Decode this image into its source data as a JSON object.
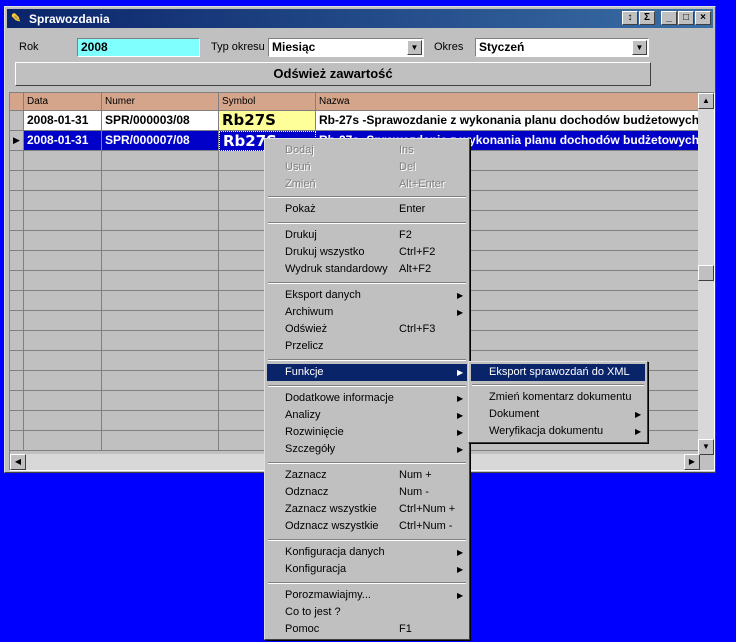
{
  "window": {
    "title": "Sprawozdania"
  },
  "titlebar_buttons": [
    "sort-icon",
    "sigma-icon",
    "minimize-icon",
    "maximize-icon",
    "close-icon"
  ],
  "filters": {
    "rok_label": "Rok",
    "rok_value": "2008",
    "typ_label": "Typ okresu",
    "typ_value": "Miesiąc",
    "okres_label": "Okres",
    "okres_value": "Styczeń"
  },
  "refresh_label": "Odśwież zawartość",
  "table": {
    "columns": [
      "Data",
      "Numer",
      "Symbol",
      "Nazwa"
    ],
    "rows": [
      {
        "data": "2008-01-31",
        "numer": "SPR/000003/08",
        "symbol": "Rb27S",
        "nazwa": "Rb-27s -Sprawozdanie z wykonania planu dochodów budżetowych"
      },
      {
        "data": "2008-01-31",
        "numer": "SPR/000007/08",
        "symbol": "Rb27S",
        "nazwa": "Rb-27s -Sprawozdanie z wykonania planu dochodów budżetowych"
      }
    ]
  },
  "context_menu": {
    "items": [
      {
        "label": "Dodaj",
        "shortcut": "Ins"
      },
      {
        "label": "Usuń",
        "shortcut": "Del"
      },
      {
        "label": "Zmień",
        "shortcut": "Alt+Enter"
      },
      {
        "label": "Pokaż",
        "shortcut": "Enter"
      },
      {
        "label": "Drukuj",
        "shortcut": "F2"
      },
      {
        "label": "Drukuj wszystko",
        "shortcut": "Ctrl+F2"
      },
      {
        "label": "Wydruk standardowy",
        "shortcut": "Alt+F2"
      },
      {
        "label": "Eksport danych",
        "shortcut": ""
      },
      {
        "label": "Archiwum",
        "shortcut": ""
      },
      {
        "label": "Odśwież",
        "shortcut": "Ctrl+F3"
      },
      {
        "label": "Przelicz",
        "shortcut": ""
      },
      {
        "label": "Funkcje",
        "shortcut": ""
      },
      {
        "label": "Dodatkowe informacje",
        "shortcut": ""
      },
      {
        "label": "Analizy",
        "shortcut": ""
      },
      {
        "label": "Rozwinięcie",
        "shortcut": ""
      },
      {
        "label": "Szczegóły",
        "shortcut": ""
      },
      {
        "label": "Zaznacz",
        "shortcut": "Num +"
      },
      {
        "label": "Odznacz",
        "shortcut": "Num -"
      },
      {
        "label": "Zaznacz wszystkie",
        "shortcut": "Ctrl+Num +"
      },
      {
        "label": "Odznacz wszystkie",
        "shortcut": "Ctrl+Num -"
      },
      {
        "label": "Konfiguracja danych",
        "shortcut": ""
      },
      {
        "label": "Konfiguracja",
        "shortcut": ""
      },
      {
        "label": "Porozmawiajmy...",
        "shortcut": ""
      },
      {
        "label": "Co to jest ?",
        "shortcut": ""
      },
      {
        "label": "Pomoc",
        "shortcut": "F1"
      }
    ]
  },
  "submenu": {
    "items": [
      {
        "label": "Eksport sprawozdań do XML"
      },
      {
        "label": "Zmień komentarz dokumentu"
      },
      {
        "label": "Dokument"
      },
      {
        "label": "Weryfikacja dokumentu"
      }
    ]
  },
  "colors": {
    "desktop": "#0000ff",
    "selection": "#0a246a",
    "header": "#d4a58b",
    "symbol_bg": "#ffff99",
    "rok_bg": "#80ffff"
  }
}
